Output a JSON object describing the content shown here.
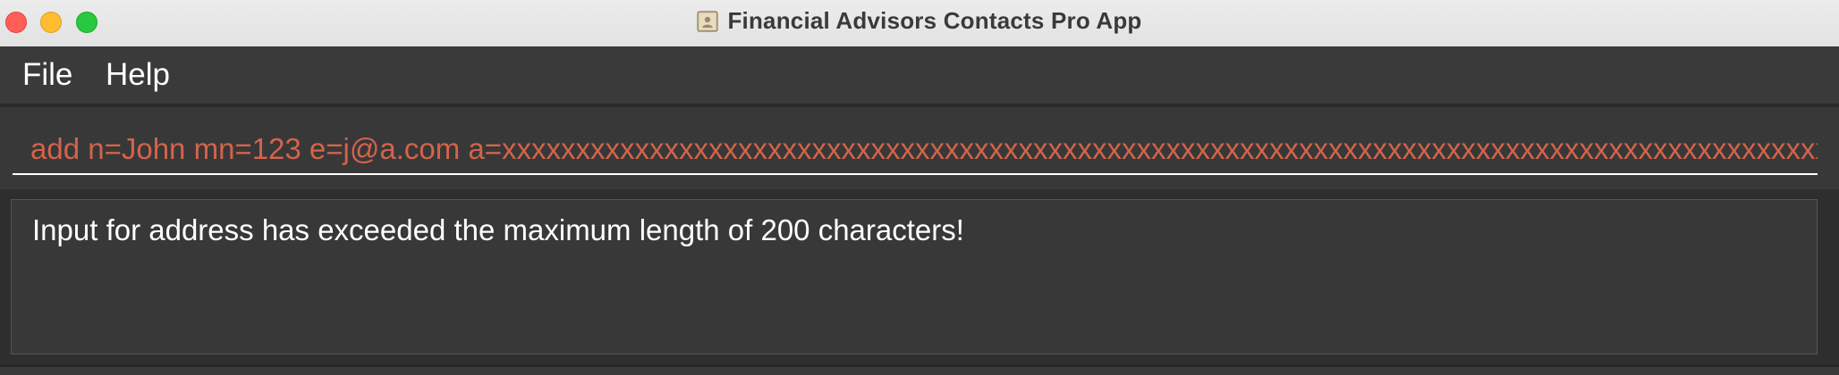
{
  "window": {
    "title": "Financial Advisors Contacts Pro App",
    "icon": "address-book-icon"
  },
  "menu": {
    "items": [
      {
        "label": "File"
      },
      {
        "label": "Help"
      }
    ]
  },
  "command_box": {
    "value": "add n=John mn=123 e=j@a.com a=xxxxxxxxxxxxxxxxxxxxxxxxxxxxxxxxxxxxxxxxxxxxxxxxxxxxxxxxxxxxxxxxxxxxxxxxxxxxxxxxxxxxxxxxxxxxx",
    "text_color": "#d4634a"
  },
  "result_display": {
    "message": "Input for address has exceeded the maximum length of 200 characters!"
  },
  "colors": {
    "close": "#ff5f57",
    "minimize": "#febc2e",
    "maximize": "#28c840",
    "background": "#2e2e2e",
    "panel": "#383838"
  }
}
